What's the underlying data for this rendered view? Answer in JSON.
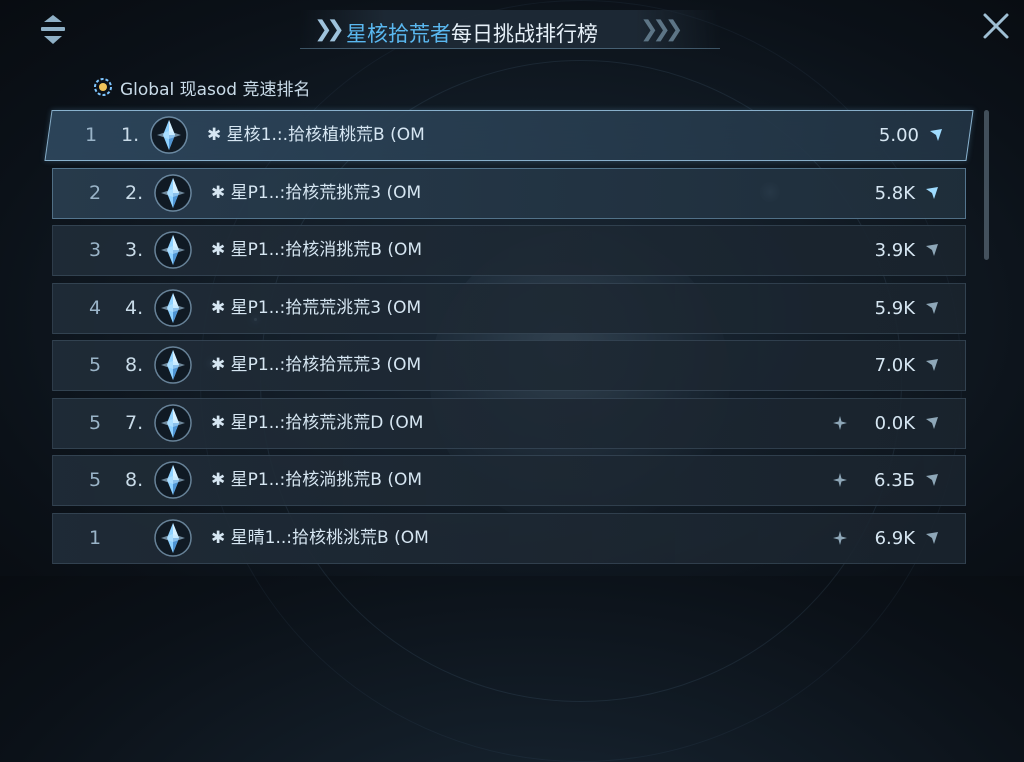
{
  "header": {
    "title_highlight": "星核拾荒者",
    "title_rest": "每日挑战排行榜"
  },
  "subheader": {
    "label": "Global 现asod 竞速排名"
  },
  "colors": {
    "accent": "#5ab8f0",
    "background": "#0b1118",
    "row_bg": "#1e2a36",
    "text": "#d6e6f2"
  },
  "icons": {
    "menu": "menu-icon",
    "close": "close-icon",
    "subheader": "gear-icon",
    "player": "crystal-icon",
    "trend": "arrow-icon",
    "sparkle": "sparkle-icon"
  },
  "rows": [
    {
      "rank": "1",
      "place": "1.",
      "name": "✱ 星核1.:.拾核植桃荒B (OM",
      "score": "5.00",
      "sparkle": false,
      "arrow": true
    },
    {
      "rank": "2",
      "place": "2.",
      "name": "✱ 星P1..:拾核荒挑荒3 (OM",
      "score": "5.8K",
      "sparkle": false,
      "arrow": true
    },
    {
      "rank": "3",
      "place": "3.",
      "name": "✱ 星P1..:拾核消挑荒B (OM",
      "score": "3.9K",
      "sparkle": false,
      "arrow": true
    },
    {
      "rank": "4",
      "place": "4.",
      "name": "✱ 星P1..:拾荒荒洮荒3 (OM",
      "score": "5.9K",
      "sparkle": false,
      "arrow": true
    },
    {
      "rank": "5",
      "place": "8.",
      "name": "✱ 星P1..:拾核拾荒荒3 (OM",
      "score": "7.0K",
      "sparkle": false,
      "arrow": true
    },
    {
      "rank": "5",
      "place": "7.",
      "name": "✱ 星P1..:拾核荒洮荒D (OM",
      "score": "0.0K",
      "sparkle": true,
      "arrow": true
    },
    {
      "rank": "5",
      "place": "8.",
      "name": "✱ 星P1..:拾核淌挑荒B (OM",
      "score": "6.3Б",
      "sparkle": true,
      "arrow": true
    },
    {
      "rank": "1",
      "place": "",
      "name": "✱ 星晴1..:拾核桃洮荒B (OM",
      "score": "6.9K",
      "sparkle": true,
      "arrow": true
    }
  ]
}
